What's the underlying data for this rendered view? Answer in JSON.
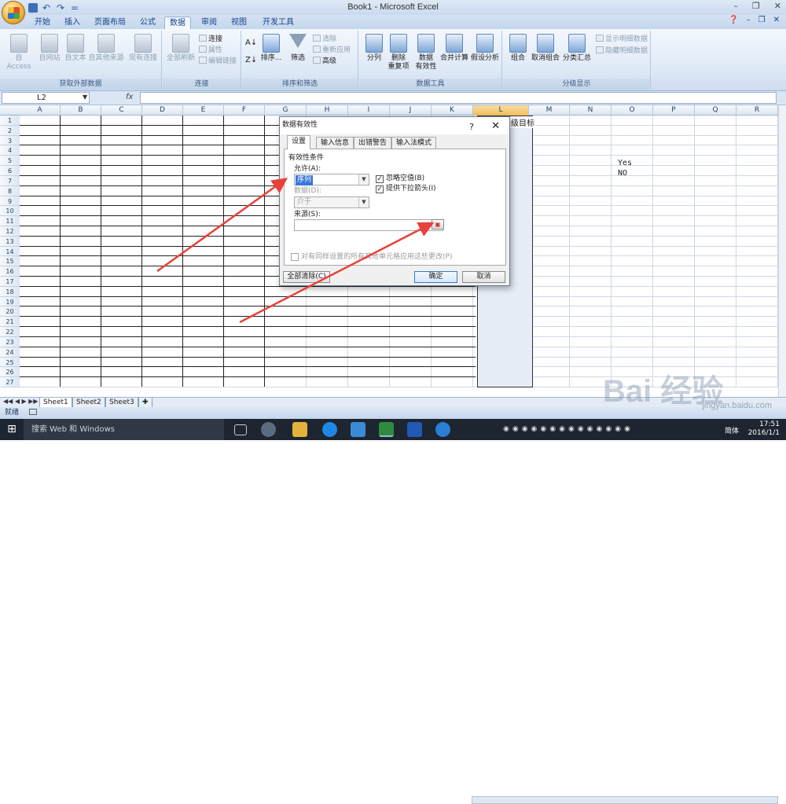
{
  "window": {
    "title": "Book1 - Microsoft Excel",
    "qat_sep": "="
  },
  "tabs": [
    "开始",
    "插入",
    "页面布局",
    "公式",
    "数据",
    "审阅",
    "视图",
    "开发工具"
  ],
  "active_tab": "数据",
  "ribbon": {
    "groups": [
      {
        "label": "获取外部数据",
        "buttons": [
          "自 Access",
          "自网站",
          "自文本",
          "自其他来源",
          "现有连接"
        ]
      },
      {
        "label": "连接",
        "main": "全部刷新",
        "small": [
          "连接",
          "属性",
          "编辑链接"
        ]
      },
      {
        "label": "排序和筛选",
        "main": [
          "排序...",
          "筛选"
        ],
        "small": [
          "清除",
          "重新应用",
          "高级"
        ]
      },
      {
        "label": "数据工具",
        "buttons": [
          "分列",
          "删除\n重复项",
          "数据\n有效性",
          "合并计算",
          "假设分析"
        ]
      },
      {
        "label": "分级显示",
        "buttons": [
          "组合",
          "取消组合",
          "分类汇总"
        ],
        "small": [
          "显示明细数据",
          "隐藏明细数据"
        ]
      }
    ]
  },
  "formula_bar": {
    "name_box": "L2",
    "fx": "fx",
    "formula": ""
  },
  "columns": [
    "A",
    "B",
    "C",
    "D",
    "E",
    "F",
    "G",
    "H",
    "I",
    "J",
    "K",
    "L",
    "M",
    "N",
    "O",
    "P",
    "Q",
    "R"
  ],
  "rows": [
    "1",
    "2",
    "3",
    "4",
    "5",
    "6",
    "7",
    "8",
    "9",
    "10",
    "11",
    "12",
    "13",
    "14",
    "15",
    "16",
    "17",
    "18",
    "19",
    "20",
    "21",
    "22",
    "23",
    "24",
    "25",
    "26",
    "27"
  ],
  "cells": {
    "L1": "级目标",
    "O5": "Yes",
    "O6": "NO"
  },
  "sheets": [
    "Sheet1",
    "Sheet2",
    "Sheet3"
  ],
  "status": "就绪",
  "dialog": {
    "title": "数据有效性",
    "help": "?",
    "close": "✕",
    "tabs": [
      "设置",
      "输入信息",
      "出错警告",
      "输入法模式"
    ],
    "section": "有效性条件",
    "allow_label": "允许(A):",
    "allow_value": "序列",
    "ignore_blank": "忽略空值(B)",
    "dropdown": "提供下拉箭头(I)",
    "data_label": "数据(D):",
    "data_value": "介于",
    "source_label": "来源(S):",
    "source_value": "",
    "apply_all": "对有同样设置的所有其他单元格应用这些更改(P)",
    "clear_all": "全部清除(C)",
    "ok": "确定",
    "cancel": "取消"
  },
  "taskbar": {
    "search": "搜索 Web 和 Windows",
    "time": "17:51",
    "date": "2016/1/1",
    "ime": "简体"
  },
  "watermark": {
    "logo": "Bai 经验",
    "url": "jingyan.baidu.com"
  },
  "colors": {
    "arrow": "#e8413c",
    "ribbon": "#dde8f6",
    "selection": "#e7edf6"
  }
}
